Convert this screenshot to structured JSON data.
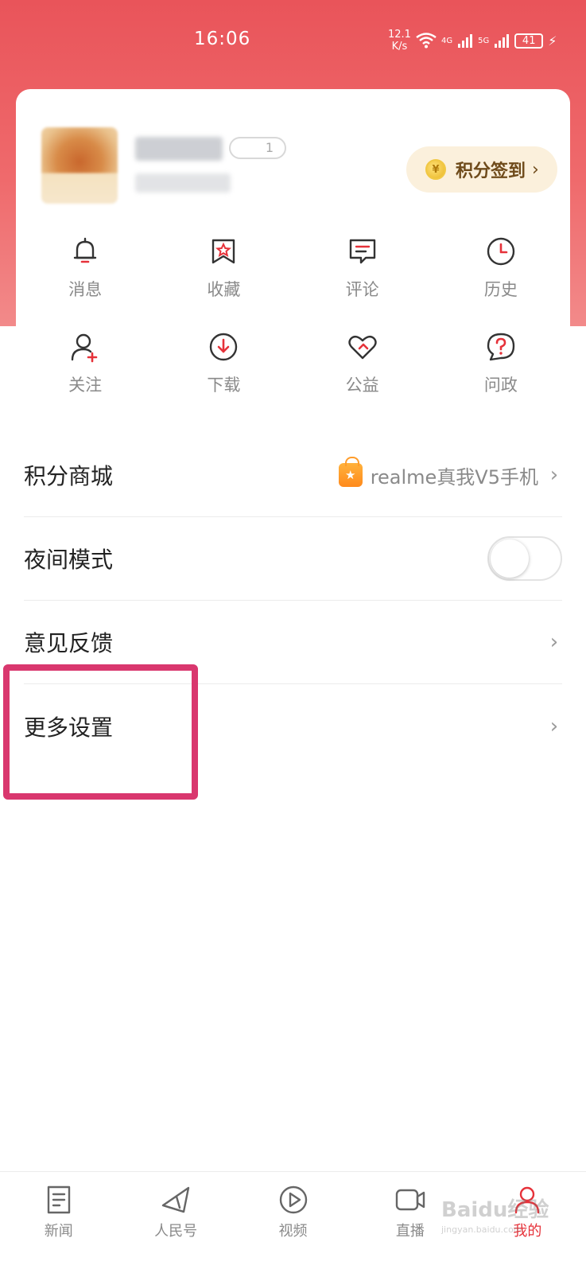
{
  "status_bar": {
    "time": "16:06",
    "net_speed_top": "12.1",
    "net_speed_bottom": "K/s",
    "network_4g": "4G",
    "network_5g": "5G",
    "battery": "41"
  },
  "profile": {
    "level_badge": "1",
    "checkin_label": "积分签到",
    "checkin_arrow": "›"
  },
  "quick_actions": [
    {
      "label": "消息",
      "icon": "bell-icon"
    },
    {
      "label": "收藏",
      "icon": "bookmark-star-icon"
    },
    {
      "label": "评论",
      "icon": "comment-icon"
    },
    {
      "label": "历史",
      "icon": "clock-icon"
    },
    {
      "label": "关注",
      "icon": "user-plus-icon"
    },
    {
      "label": "下载",
      "icon": "download-icon"
    },
    {
      "label": "公益",
      "icon": "heart-icon"
    },
    {
      "label": "问政",
      "icon": "question-bubble-icon"
    }
  ],
  "menu": {
    "points_mall": {
      "label": "积分商城",
      "promo": "realme真我V5手机"
    },
    "night_mode": {
      "label": "夜间模式",
      "enabled": false
    },
    "feedback": {
      "label": "意见反馈"
    },
    "more_settings": {
      "label": "更多设置"
    }
  },
  "tabs": [
    {
      "label": "新闻",
      "icon": "news-icon"
    },
    {
      "label": "人民号",
      "icon": "paper-plane-icon"
    },
    {
      "label": "视频",
      "icon": "play-circle-icon"
    },
    {
      "label": "直播",
      "icon": "video-camera-icon"
    },
    {
      "label": "我的",
      "icon": "profile-icon",
      "active": true
    }
  ],
  "watermark": {
    "brand": "Baidu经验",
    "url": "jingyan.baidu.com"
  },
  "colors": {
    "header_red": "#e9545a",
    "accent_red": "#e6323a",
    "highlight_pink": "#d9376e",
    "checkin_bg": "#fbf0dc"
  }
}
